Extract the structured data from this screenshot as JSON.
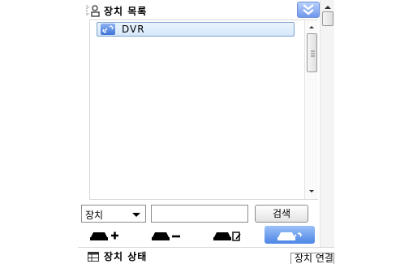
{
  "device_list": {
    "title": "장치 목록",
    "items": [
      {
        "label": "DVR",
        "icon": "link-device-icon",
        "selected": true
      }
    ]
  },
  "search": {
    "filter_selected": "장치",
    "query_value": "",
    "query_placeholder": "",
    "search_button_label": "검색"
  },
  "toolbar": {
    "buttons": [
      {
        "icon": "add-device-icon"
      },
      {
        "icon": "remove-device-icon"
      },
      {
        "icon": "edit-device-icon"
      },
      {
        "icon": "connect-device-icon",
        "active": true
      }
    ]
  },
  "status": {
    "title": "장치 상태",
    "tab_label": "장치 연결"
  },
  "colors": {
    "accent": "#4d86e6",
    "selection": "#d6e8fb"
  }
}
